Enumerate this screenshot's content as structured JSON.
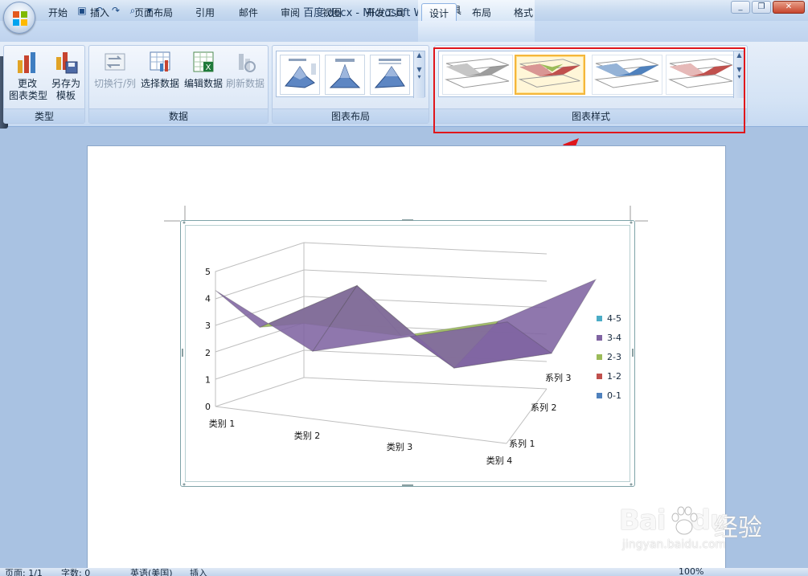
{
  "window": {
    "title": "百度.docx - Microsoft Word",
    "context_tab_title": "图表工具"
  },
  "tabs": [
    "开始",
    "插入",
    "页面布局",
    "引用",
    "邮件",
    "审阅",
    "视图",
    "开发工具",
    "设计",
    "布局",
    "格式"
  ],
  "active_tab": "设计",
  "ribbon": {
    "type_group": {
      "label": "类型",
      "change_type": "更改\n图表类型",
      "save_template": "另存为\n模板"
    },
    "data_group": {
      "label": "数据",
      "switch_row_col": "切换行/列",
      "select_data": "选择数据",
      "edit_data": "编辑数据",
      "refresh_data": "刷新数据"
    },
    "layout_group": {
      "label": "图表布局"
    },
    "style_group": {
      "label": "图表样式"
    }
  },
  "status": {
    "page": "页面: 1/1",
    "words": "字数: 0",
    "language": "英语(美国)",
    "mode": "插入",
    "zoom": "100%"
  },
  "watermark": {
    "brand": "Bai",
    "brand_tail": "du",
    "cn": "经验",
    "url": "jingyan.baidu.com"
  },
  "colors": {
    "band_4_5": "#4bacc6",
    "band_3_4": "#8064a2",
    "band_2_3": "#9bbb59",
    "band_1_2": "#c0504d",
    "band_0_1": "#4f81bd",
    "highlight": "#e0161b"
  },
  "chart_data": {
    "type": "surface",
    "categories": [
      "类别 1",
      "类别 2",
      "类别 3",
      "类别 4"
    ],
    "series_axis": [
      "系列 1",
      "系列 2",
      "系列 3"
    ],
    "y_ticks": [
      "0",
      "1",
      "2",
      "3",
      "4",
      "5"
    ],
    "ylim": [
      0,
      5
    ],
    "legend": [
      "4-5",
      "3-4",
      "2-3",
      "1-2",
      "0-1"
    ],
    "legend_position": "right",
    "series": [
      {
        "values": [
          4.3,
          2.5,
          3.5,
          4.5
        ]
      },
      {
        "values": [
          2.4,
          4.4,
          1.8,
          2.8
        ]
      },
      {
        "values": [
          2,
          2,
          3,
          5
        ]
      }
    ]
  }
}
